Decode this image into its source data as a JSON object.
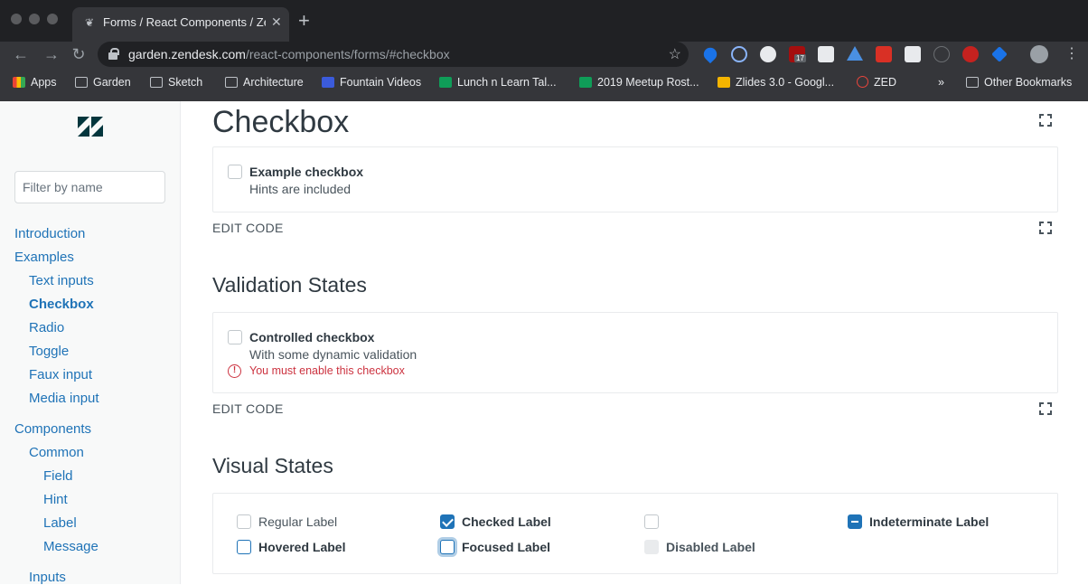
{
  "browser": {
    "tab_title": "Forms / React Components / Zendesk Garden",
    "url_host": "garden.zendesk.com",
    "url_path": "/react-components/forms/#checkbox",
    "extension_badge": "17",
    "bookmarks": [
      {
        "label": "Apps",
        "icon": "apps-grid-icon",
        "color": "#ea4335"
      },
      {
        "label": "Garden",
        "icon": "folder-icon",
        "color": ""
      },
      {
        "label": "Sketch",
        "icon": "folder-icon",
        "color": ""
      },
      {
        "label": "Architecture",
        "icon": "folder-icon",
        "color": ""
      },
      {
        "label": "Fountain Videos",
        "icon": "fountain-icon",
        "color": "#3b5bdb"
      },
      {
        "label": "Lunch n Learn Tal...",
        "icon": "sheets-icon",
        "color": "#0f9d58"
      },
      {
        "label": "2019 Meetup Rost...",
        "icon": "sheets-icon",
        "color": "#0f9d58"
      },
      {
        "label": "Zlides 3.0 - Googl...",
        "icon": "slides-icon",
        "color": "#f4b400"
      },
      {
        "label": "ZED",
        "icon": "zed-icon",
        "color": "#e8453c"
      }
    ],
    "overflow_label": "»",
    "other_bookmarks": "Other Bookmarks"
  },
  "sidebar": {
    "filter_placeholder": "Filter by name",
    "nav": [
      {
        "label": "Introduction",
        "indent": 0,
        "active": false
      },
      {
        "label": "Examples",
        "indent": 0,
        "active": false
      },
      {
        "label": "Text inputs",
        "indent": 1,
        "active": false
      },
      {
        "label": "Checkbox",
        "indent": 1,
        "active": true
      },
      {
        "label": "Radio",
        "indent": 1,
        "active": false
      },
      {
        "label": "Toggle",
        "indent": 1,
        "active": false
      },
      {
        "label": "Faux input",
        "indent": 1,
        "active": false
      },
      {
        "label": "Media input",
        "indent": 1,
        "active": false
      },
      {
        "label": "Components",
        "indent": 0,
        "active": false
      },
      {
        "label": "Common",
        "indent": 1,
        "active": false
      },
      {
        "label": "Field",
        "indent": 2,
        "active": false
      },
      {
        "label": "Hint",
        "indent": 2,
        "active": false
      },
      {
        "label": "Label",
        "indent": 2,
        "active": false
      },
      {
        "label": "Message",
        "indent": 2,
        "active": false
      },
      {
        "label": "Inputs",
        "indent": 1,
        "active": false
      }
    ]
  },
  "main": {
    "title": "Checkbox",
    "example": {
      "label": "Example checkbox",
      "hint": "Hints are included",
      "edit_code": "EDIT CODE"
    },
    "validation": {
      "heading": "Validation States",
      "label": "Controlled checkbox",
      "hint": "With some dynamic validation",
      "error": "You must enable this checkbox",
      "edit_code": "EDIT CODE"
    },
    "visual": {
      "heading": "Visual States",
      "items": [
        {
          "label": "Regular Label",
          "state": "regular"
        },
        {
          "label": "Checked Label",
          "state": "checked"
        },
        {
          "label": "",
          "state": "unlabeled"
        },
        {
          "label": "Indeterminate Label",
          "state": "indeterminate"
        },
        {
          "label": "Hovered Label",
          "state": "hovered"
        },
        {
          "label": "Focused Label",
          "state": "focused"
        },
        {
          "label": "Disabled Label",
          "state": "disabled"
        }
      ]
    }
  },
  "colors": {
    "accent": "#1f73b7",
    "danger": "#cc3340",
    "text": "#2f3941"
  }
}
